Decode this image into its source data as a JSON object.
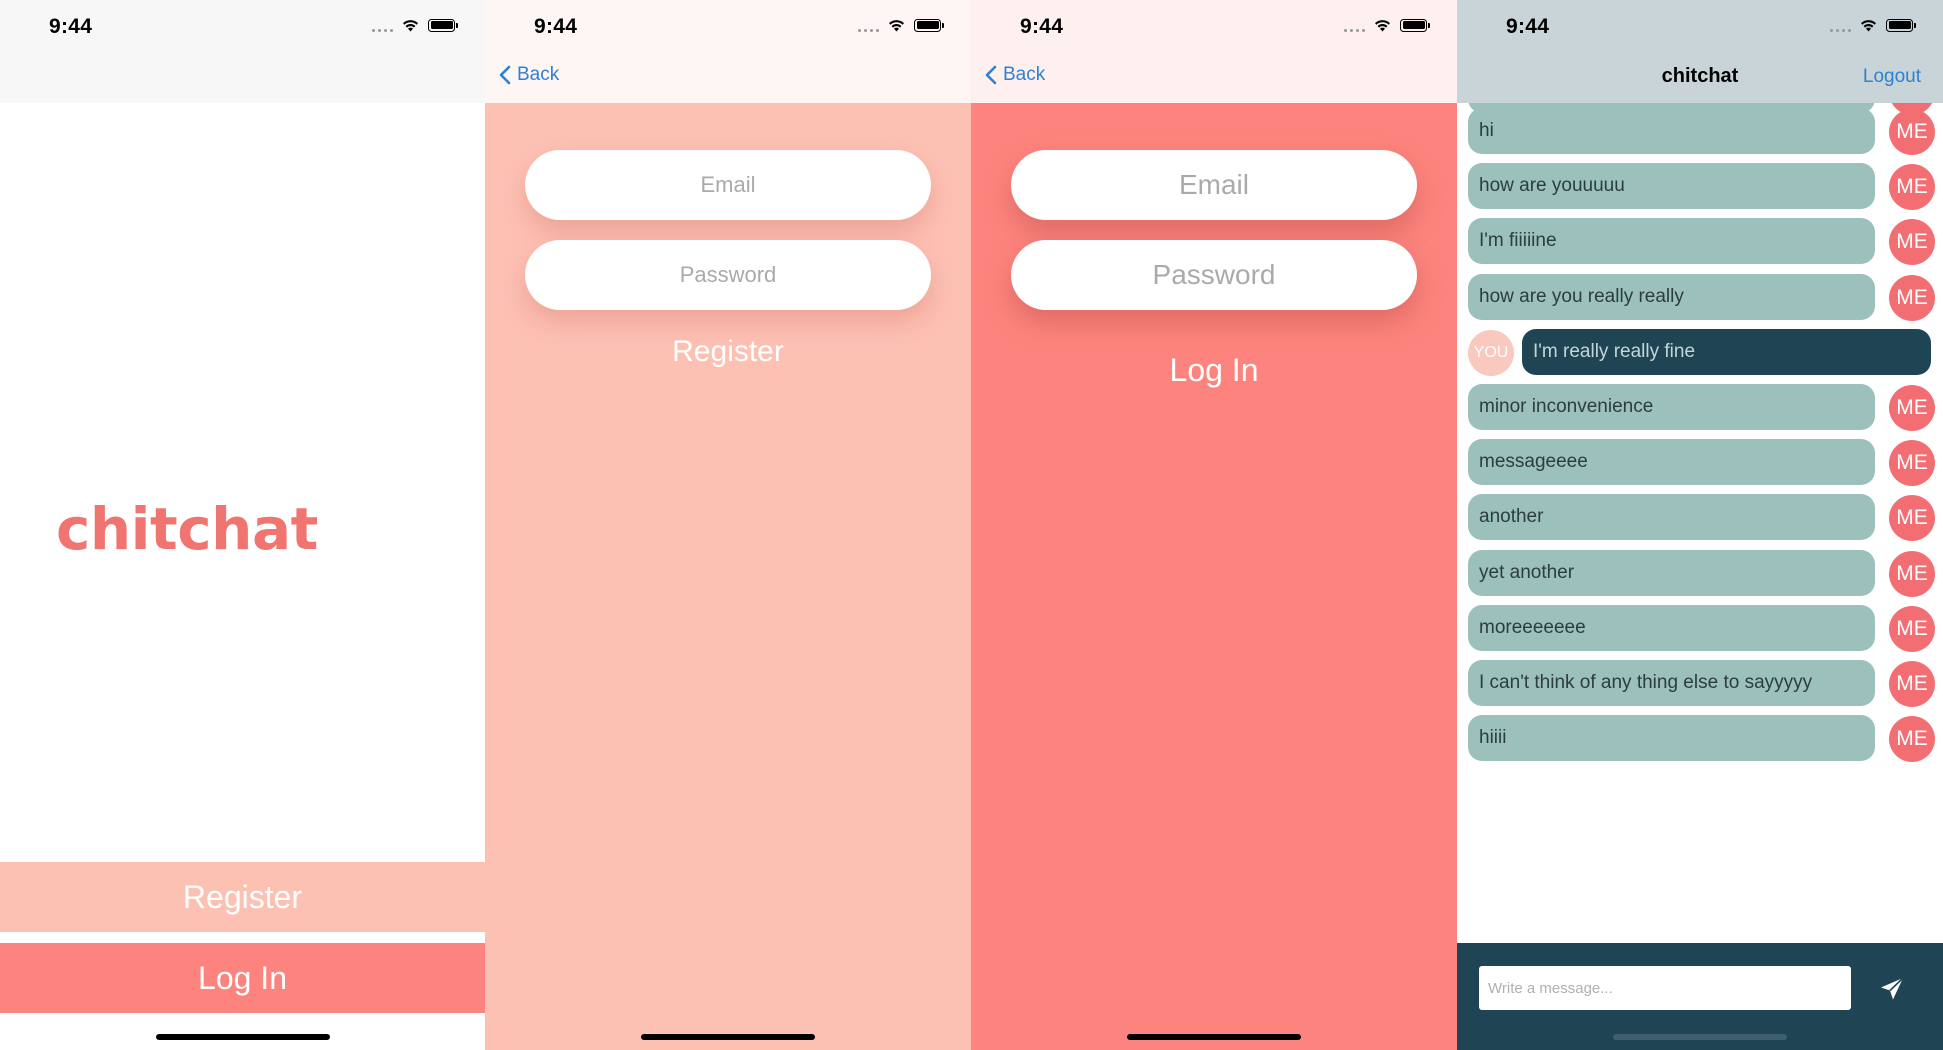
{
  "status_bar": {
    "time": "9:44"
  },
  "welcome": {
    "brand": "chitchat",
    "register_label": "Register",
    "login_label": "Log In"
  },
  "register": {
    "back_label": "Back",
    "email_placeholder": "Email",
    "password_placeholder": "Password",
    "submit_label": "Register"
  },
  "login": {
    "back_label": "Back",
    "email_placeholder": "Email",
    "password_placeholder": "Password",
    "submit_label": "Log In"
  },
  "chat": {
    "title": "chitchat",
    "logout_label": "Logout",
    "messages": [
      {
        "sender": "ME",
        "text": "hi"
      },
      {
        "sender": "ME",
        "text": "how are youuuuu"
      },
      {
        "sender": "ME",
        "text": "I'm fiiiiine"
      },
      {
        "sender": "ME",
        "text": "how are you really really"
      },
      {
        "sender": "YOU",
        "text": "I'm really really fine"
      },
      {
        "sender": "ME",
        "text": "minor inconvenience"
      },
      {
        "sender": "ME",
        "text": "messageeee"
      },
      {
        "sender": "ME",
        "text": "another"
      },
      {
        "sender": "ME",
        "text": "yet another"
      },
      {
        "sender": "ME",
        "text": "moreeeeeee"
      },
      {
        "sender": "ME",
        "text": "I can't think of any thing else to sayyyyy"
      },
      {
        "sender": "ME",
        "text": "hiiii"
      }
    ],
    "composer_placeholder": "Write a message...",
    "send_icon": "paper-plane-icon"
  },
  "colors": {
    "brand": "#f07570",
    "register_bg": "#fdc1b4",
    "login_bg": "#fd847e",
    "link_blue": "#2f7fd3",
    "me_bubble": "#9cc0bc",
    "you_bubble": "#1f4555",
    "me_avatar": "#f26e72",
    "you_avatar": "#f9c8bf"
  }
}
